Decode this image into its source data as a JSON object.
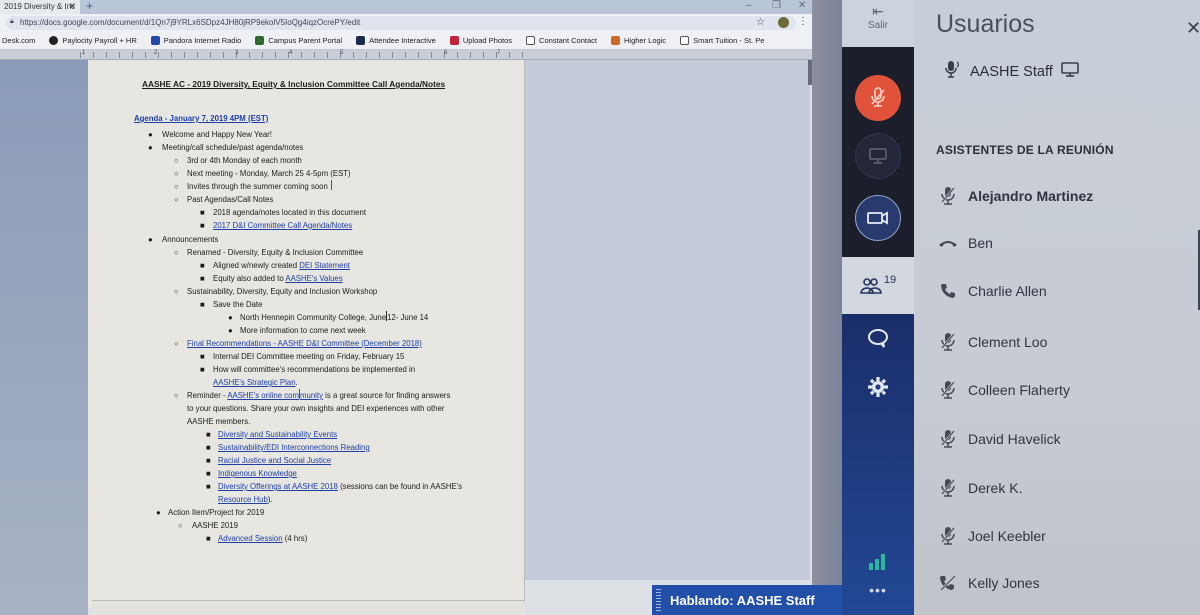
{
  "browser": {
    "tab_title": "2019 Diversity & Inc",
    "new_tab": "+",
    "url": "https://docs.google.com/document/d/1Qn7j9YRLx6SDpz4JH80jRP9ekolV5IoQg4iqzOcrePY/edit",
    "window_controls": [
      "–",
      "❐",
      "✕"
    ],
    "bookmarks": [
      {
        "label": "Desk.com",
        "color": ""
      },
      {
        "label": "Paylocity Payroll + HR",
        "color": "#222222"
      },
      {
        "label": "Pandora Internet Radio",
        "color": "#224aa8"
      },
      {
        "label": "Campus Parent Portal",
        "color": "#2f6b2c"
      },
      {
        "label": "Attendee Interactive",
        "color": "#1a2a4a"
      },
      {
        "label": "Upload Photos",
        "color": "#c0243a"
      },
      {
        "label": "Constant Contact",
        "color": "#ffffff"
      },
      {
        "label": "Higher Logic",
        "color": "#d0682a"
      },
      {
        "label": "Smart Tuition - St. Pe",
        "color": "#ffffff"
      }
    ],
    "ruler_numbers": [
      "1",
      "2",
      "3",
      "4",
      "5",
      "6",
      "7"
    ]
  },
  "document": {
    "title": "AASHE AC - 2019 Diversity, Equity & Inclusion Committee Call Agenda/Notes",
    "agenda_heading": "Agenda - January 7, 2019 4PM (EST)",
    "items": {
      "welcome": "Welcome and Happy New Year!",
      "schedule": "Meeting/call schedule/past agenda/notes",
      "monday": "3rd or 4th Monday of each month",
      "next_meeting": "Next meeting - Monday, March 25 4-5pm (EST)",
      "invites": "Invites through the summer coming soon",
      "past": "Past Agendas/Call Notes",
      "notes2018": "2018 agenda/notes located in this document",
      "notes2017_link": "2017 D&I Committee Call Agenda/Notes",
      "announcements": "Announcements",
      "renamed": "Renamed - Diversity, Equity & Inclusion Committee",
      "aligned": "Aligned w/newly created ",
      "aligned_link": "DEI Statement",
      "equity": "Equity also added to ",
      "equity_link": "AASHE's Values",
      "workshop": "Sustainability, Diversity, Equity and Inclusion Workshop",
      "save_date": "Save the Date",
      "college_a": "North Hennepin Community College, June",
      "college_b": "12- June 14",
      "more_info": "More information to come next week",
      "final_rec_link": "Final Recommendations - AASHE D&I Committee (December 2018)",
      "internal": "Internal DEI Committee meeting on Friday, February 15",
      "how_will": "How will committee's recommendations be implemented in",
      "strategic_link": "AASHE's Strategic Plan",
      "strategic_end": ".",
      "reminder": "Reminder - ",
      "community_link_a": "AASHE's online com",
      "community_link_b": "munity",
      "reminder_rest": " is a great source for finding answers",
      "reminder_l2": "to your questions. Share your own insights and DEI experiences with other",
      "reminder_l3": "AASHE members.",
      "link_events": "Diversity and Sustainability Events",
      "link_reading": "Sustainability/EDI Interconnections Reading",
      "link_justice": "Racial Justice and Social Justice",
      "link_indigenous": "Indigenous Knowledge",
      "link_offerings": "Diversity Offerings at AASHE 2018",
      "offerings_rest": " (sessions can be found in AASHE's",
      "resource_link": "Resource Hub",
      "resource_end": ").",
      "action": "Action Item/Project for 2019",
      "aashe2019": "AASHE 2019",
      "advanced_link": "Advanced Session",
      "advanced_rest": " (4 hrs)"
    }
  },
  "meeting": {
    "exit_label": "Salir",
    "users_count": "19",
    "speaking_label": "Hablando: AASHE Staff",
    "colors": {
      "mic_muted": "#e0533a",
      "rail": "#1e3a7a",
      "signal": "#2fb6a0",
      "speaking_bar": "#2250a8"
    },
    "panel": {
      "title": "Usuarios",
      "close": "✕",
      "presenter": {
        "name": "AASHE Staff",
        "status_icon": "mic-talking-icon",
        "extra_icon": "monitor-icon"
      },
      "section_heading": "ASISTENTES DE LA REUNIÓN",
      "attendees": [
        {
          "name": "Alejandro Martinez",
          "status": "mic-muted",
          "bold": true
        },
        {
          "name": "Ben",
          "status": "phone-hangup"
        },
        {
          "name": "Charlie Allen",
          "status": "phone"
        },
        {
          "name": "Clement Loo",
          "status": "mic-muted"
        },
        {
          "name": "Colleen Flaherty",
          "status": "mic-muted"
        },
        {
          "name": "David Havelick",
          "status": "mic-muted"
        },
        {
          "name": "Derek K.",
          "status": "mic-muted"
        },
        {
          "name": "Joel Keebler",
          "status": "mic-muted"
        },
        {
          "name": "Kelly Jones",
          "status": "phone-muted"
        }
      ]
    }
  }
}
